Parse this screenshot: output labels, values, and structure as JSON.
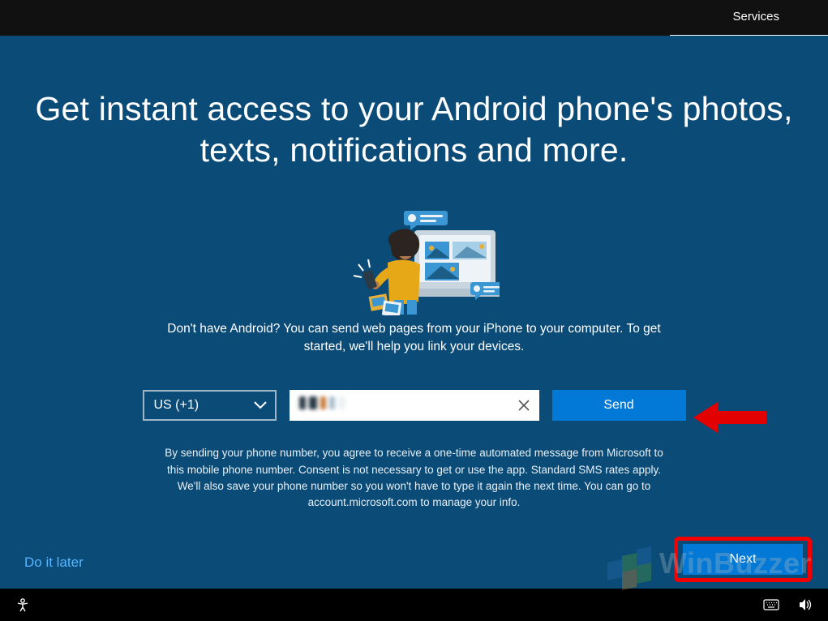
{
  "topbar": {
    "tab_label": "Services"
  },
  "headline": "Get instant access to your Android phone's photos, texts, notifications and more.",
  "subtitle": "Don't have Android? You can send web pages from your iPhone to your computer. To get started, we'll help you link your devices.",
  "form": {
    "country_selected": "US (+1)",
    "phone_value": "",
    "send_label": "Send"
  },
  "disclaimer": "By sending your phone number, you agree to receive a one-time automated message from Microsoft to this mobile phone number.  Consent is not necessary to get or use the app.  Standard SMS rates apply. We'll also save your phone number so you won't have to type it again the next time. You can go to account.microsoft.com to manage your info.",
  "actions": {
    "do_it_later": "Do it later",
    "next": "Next"
  },
  "watermark": {
    "text": "WinBuzzer"
  },
  "colors": {
    "bg": "#0a4b78",
    "accent": "#0279d6",
    "highlight": "#f20000"
  }
}
